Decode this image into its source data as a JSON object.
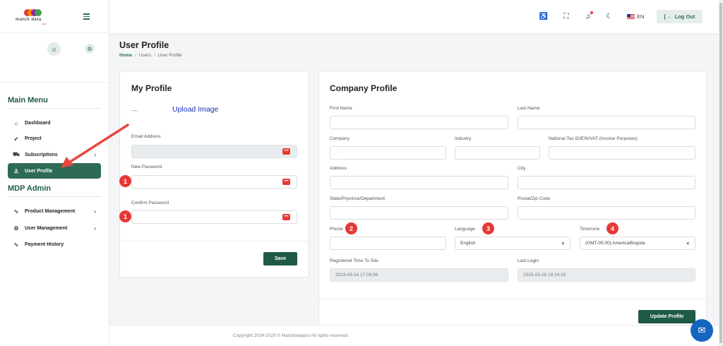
{
  "brand": {
    "logo_text": "match data",
    "logo_sub": "pro"
  },
  "sidebar": {
    "main_menu_heading": "Main Menu",
    "main_menu": [
      {
        "label": "Dashboard"
      },
      {
        "label": "Project"
      },
      {
        "label": "Subscriptions"
      },
      {
        "label": "User Profile"
      }
    ],
    "admin_heading": "MDP Admin",
    "admin_menu": [
      {
        "label": "Product Management"
      },
      {
        "label": "User Management"
      },
      {
        "label": "Payment History"
      }
    ]
  },
  "topbar": {
    "language": "EN",
    "logout_label": "Log Out"
  },
  "page": {
    "title": "User Profile",
    "breadcrumb": [
      "Home",
      "Users",
      "User Profile"
    ]
  },
  "my_profile": {
    "title": "My Profile",
    "upload_label": "Upload Image",
    "email_label": "Email Address",
    "email_value": "",
    "new_password_label": "New Password",
    "confirm_password_label": "Confirm Password",
    "save_label": "Save"
  },
  "company_profile": {
    "title": "Company Profile",
    "first_name_label": "First Name",
    "last_name_label": "Last Name",
    "company_label": "Company",
    "company_value": "-",
    "industry_label": "Industry",
    "tax_id_label": "National Tax ID/EIN/VAT (Invoice Purposes)",
    "address_label": "Address",
    "city_label": "City",
    "state_label": "State/Prpvince/Department",
    "postal_label": "Postal/Zip Code",
    "phone_label": "Phone",
    "language_label": "Language",
    "language_value": "English",
    "timezone_label": "Timezone",
    "timezone_value": "(GMT-05:00) America/Bogota",
    "registered_label": "Registered Time To Site",
    "registered_value": "2023-08-24 17:09:56",
    "last_login_label": "Last Login",
    "last_login_value": "2025-03-28 18:14:29",
    "update_label": "Update Profile"
  },
  "annotations": {
    "badge_1": "1",
    "badge_2": "2",
    "badge_3": "3",
    "badge_4": "4"
  },
  "footer": {
    "copyright": "Copyright 2024-2025 © Matchdatapro All rights reserved."
  },
  "colors": {
    "accent": "#2e6b55",
    "button": "#1f5a46",
    "badge": "#e53935",
    "arrow": "#e8473f"
  }
}
